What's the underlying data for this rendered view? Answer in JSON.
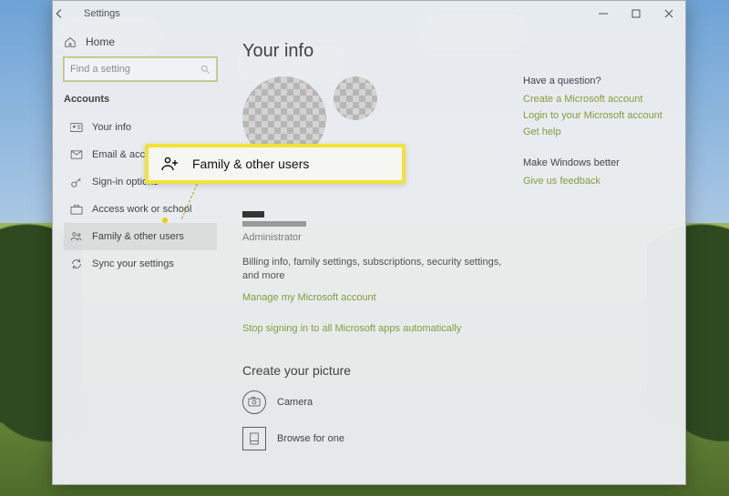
{
  "window": {
    "title": "Settings"
  },
  "sidebar": {
    "home": "Home",
    "search_placeholder": "Find a setting",
    "category": "Accounts",
    "items": [
      {
        "label": "Your info"
      },
      {
        "label": "Email & accounts"
      },
      {
        "label": "Sign-in options"
      },
      {
        "label": "Access work or school"
      },
      {
        "label": "Family & other users"
      },
      {
        "label": "Sync your settings"
      }
    ]
  },
  "main": {
    "title": "Your info",
    "role": "Administrator",
    "billing_desc": "Billing info, family settings, subscriptions, security settings, and more",
    "manage_link": "Manage my Microsoft account",
    "stop_link": "Stop signing in to all Microsoft apps automatically",
    "picture_heading": "Create your picture",
    "camera": "Camera",
    "browse": "Browse for one"
  },
  "right": {
    "q_heading": "Have a question?",
    "links": [
      "Create a Microsoft account",
      "Login to your Microsoft account",
      "Get help"
    ],
    "better_heading": "Make Windows better",
    "feedback": "Give us feedback"
  },
  "callout": {
    "label": "Family & other users"
  }
}
